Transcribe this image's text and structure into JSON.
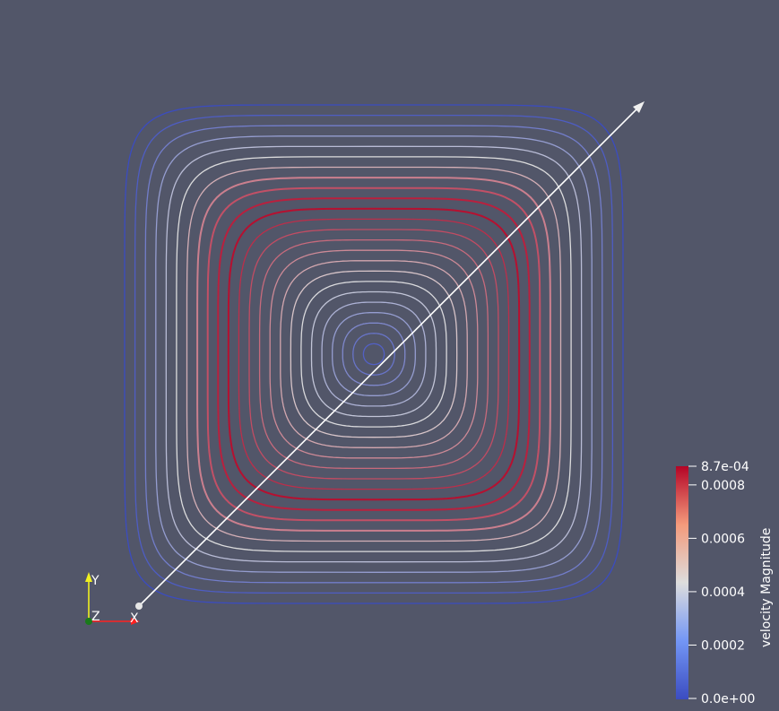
{
  "colors": {
    "background": "#525669",
    "cool": "#3b4cc0",
    "neutral": "#dddddd",
    "warm": "#b40426",
    "probe_line": "#ffffff",
    "axis_x": "#ff2020",
    "axis_y": "#f0f020",
    "axis_z_dot": "#1a7a1a",
    "label_text": "#ffffff"
  },
  "orientation_axes": {
    "x_label": "X",
    "y_label": "Y",
    "z_label": "Z"
  },
  "color_bar": {
    "title": "velocity Magnitude",
    "colormap": "Cool to Warm",
    "range": [
      0.0,
      0.00087
    ],
    "max_label": "8.7e-04",
    "min_label": "0.0e+00",
    "ticks": [
      {
        "value": 0.0008,
        "label": "0.0008"
      },
      {
        "value": 0.0006,
        "label": "0.0006"
      },
      {
        "value": 0.0004,
        "label": "0.0004"
      },
      {
        "value": 0.0002,
        "label": "0.0002"
      }
    ]
  },
  "streamlines": {
    "pattern": "single vortex in square cavity",
    "count": 24,
    "speed_max_fraction_of_radius": 0.6
  },
  "probe_line": {
    "widget": "line",
    "arrow_end": true
  }
}
